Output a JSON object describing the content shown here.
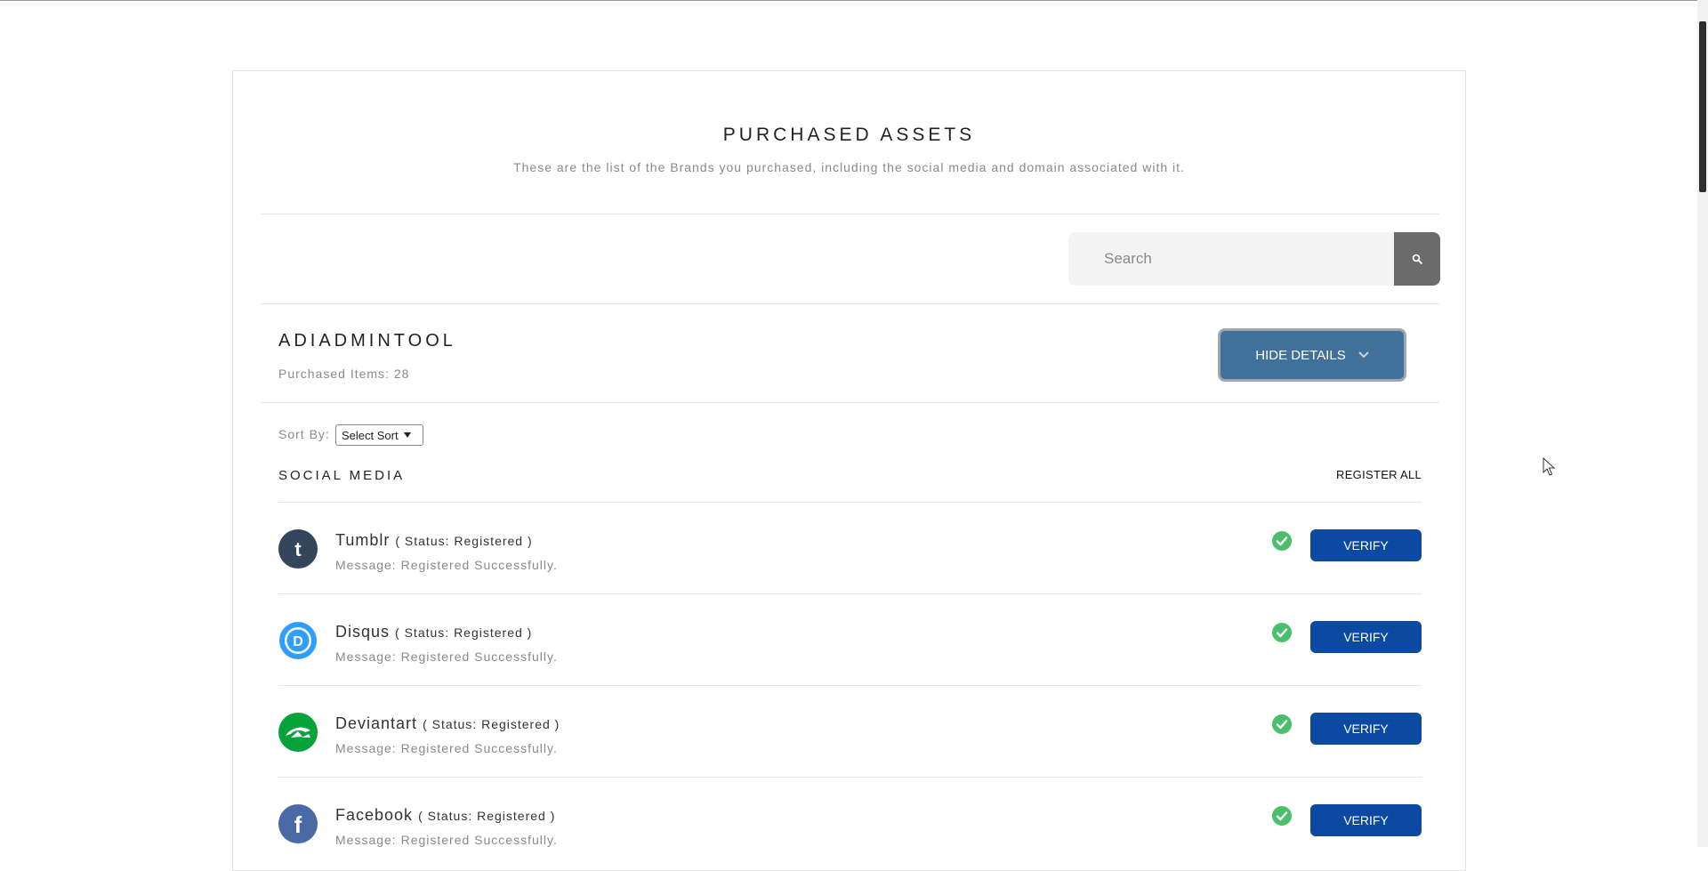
{
  "page": {
    "title": "PURCHASED ASSETS",
    "subtitle": "These are the list of the Brands you purchased, including the social media and domain associated with it."
  },
  "search": {
    "placeholder": "Search",
    "icon": "search-icon"
  },
  "brand": {
    "name": "ADIADMINTOOL",
    "purchased_items": "Purchased Items: 28",
    "toggle_label": "HIDE DETAILS"
  },
  "sort": {
    "label": "Sort By:",
    "selected": "Select Sort"
  },
  "social_media": {
    "title": "SOCIAL MEDIA",
    "register_all_label": "REGISTER ALL",
    "items": [
      {
        "name": "Tumblr",
        "status": "( Status: Registered )",
        "message": "Message: Registered Successfully.",
        "verify_label": "VERIFY",
        "icon": "tumblr-icon",
        "icon_color": "#35465c"
      },
      {
        "name": "Disqus",
        "status": "( Status: Registered )",
        "message": "Message: Registered Successfully.",
        "verify_label": "VERIFY",
        "icon": "disqus-icon",
        "icon_color": "#2e9fff"
      },
      {
        "name": "Deviantart",
        "status": "( Status: Registered )",
        "message": "Message: Registered Successfully.",
        "verify_label": "VERIFY",
        "icon": "deviantart-icon",
        "icon_color": "#05a33a"
      },
      {
        "name": "Facebook",
        "status": "( Status: Registered )",
        "message": "Message: Registered Successfully.",
        "verify_label": "VERIFY",
        "icon": "facebook-icon",
        "icon_color": "#4a6aa5"
      }
    ]
  },
  "colors": {
    "toggle_button": "#41709b",
    "verify_button": "#0c49a3",
    "success_check": "#4bbf6b",
    "search_button": "#6b6b6b"
  }
}
